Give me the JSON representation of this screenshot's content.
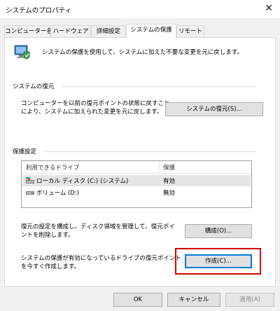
{
  "window": {
    "title": "システムのプロパティ",
    "close_glyph": "✕"
  },
  "tabs": [
    {
      "label": "コンピューター名",
      "active": false
    },
    {
      "label": "ハードウェア",
      "active": false
    },
    {
      "label": "詳細設定",
      "active": false
    },
    {
      "label": "システムの保護",
      "active": true
    },
    {
      "label": "リモート",
      "active": false
    }
  ],
  "intro": {
    "icon": "system-protection-shield-icon",
    "text": "システムの保護を使用して、システムに加えた不要な変更を元に戻します。"
  },
  "restore_section": {
    "label": "システムの復元",
    "description_line1": "コンピューターを以前の復元ポイントの状態に戻すこと",
    "description_line2": "により、システムに加えられた変更を元に戻します。",
    "button_label": "システムの復元(S)..."
  },
  "protection_section": {
    "label": "保護設定",
    "table": {
      "columns": [
        "利用できるドライブ",
        "保護"
      ],
      "rows": [
        {
          "drive": "ローカル ディスク (C:) (システム)",
          "protection": "有効",
          "icon": "system-drive-icon",
          "selected": true
        },
        {
          "drive": "ボリューム (D:)",
          "protection": "無効",
          "icon": "drive-icon",
          "selected": false
        }
      ]
    },
    "configure_text_line1": "復元の設定を構成し、ディスク領域を管理して、復元ポイ",
    "configure_text_line2": "ントを削除します。",
    "configure_button": "構成(O)...",
    "create_text_line1": "システムの保護が有効になっているドライブの復元ポイント",
    "create_text_line2": "を今すぐ作成します。",
    "create_button": "作成(C)..."
  },
  "footer": {
    "ok": "OK",
    "cancel": "キャンセル",
    "apply": "適用(A)"
  },
  "colors": {
    "highlight": "#d50000",
    "focus": "#0078d7"
  }
}
